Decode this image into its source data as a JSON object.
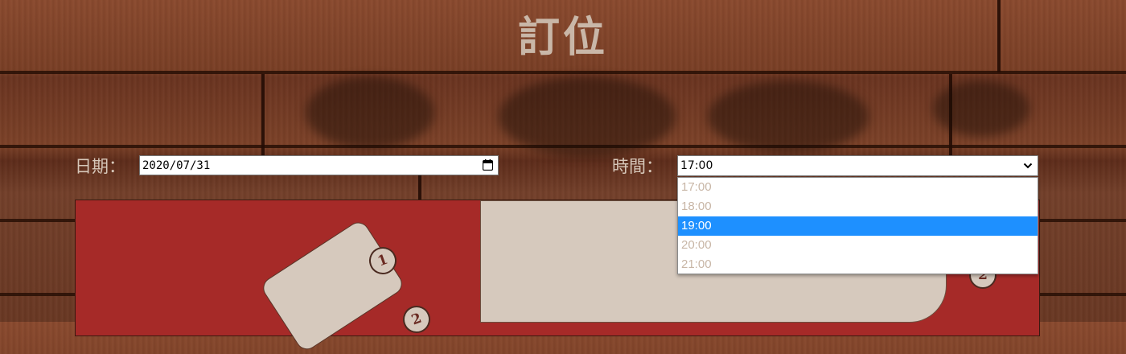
{
  "page": {
    "title": "訂位"
  },
  "form": {
    "date_label": "日期：",
    "date_value": "2020/07/31",
    "time_label": "時間：",
    "time_value": "17:00",
    "time_options": [
      "17:00",
      "18:00",
      "19:00",
      "20:00",
      "21:00"
    ],
    "highlighted_option": "19:00"
  },
  "floor_plan": {
    "seats": [
      "1",
      "2",
      "2"
    ]
  },
  "colors": {
    "floor_red": "#a62a28",
    "table_beige": "#d6c9bd",
    "highlight_blue": "#1e90ff"
  },
  "icons": [
    "calendar-icon",
    "chevron-down-icon"
  ]
}
